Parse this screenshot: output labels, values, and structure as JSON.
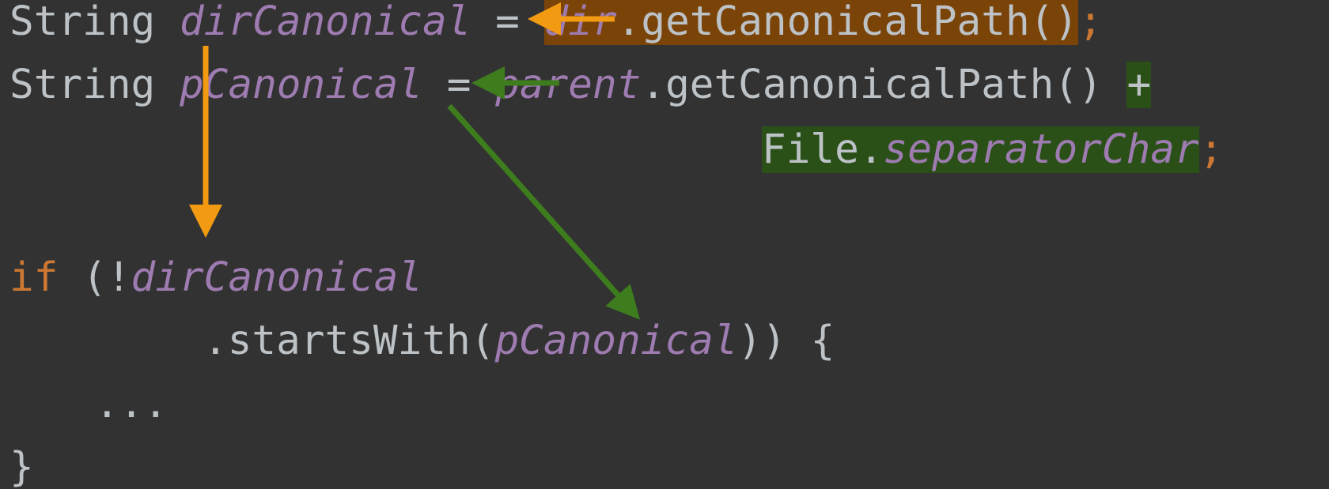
{
  "code": {
    "line1": {
      "type": "String",
      "var": "dirCanonical",
      "assign": " = ",
      "obj": "dir",
      "call": ".getCanonicalPath()",
      "semi": ";"
    },
    "line2": {
      "type": "String",
      "var": "pCanonical",
      "assign": " = ",
      "obj": "parent",
      "call": ".getCanonicalPath() ",
      "plus": "+"
    },
    "line3": {
      "cls": "File.",
      "field": "separatorChar",
      "semi": ";"
    },
    "line4": {
      "kw": "if",
      "open": " (!",
      "var": "dirCanonical"
    },
    "line5": {
      "method": ".startsWith(",
      "arg": "pCanonical",
      "close": ")) {"
    },
    "line6": {
      "ellipsis": "..."
    },
    "line7": {
      "brace": "}"
    }
  },
  "colors": {
    "background": "#323232",
    "text": "#bcc2c6",
    "variable": "#9e7bb0",
    "keyword": "#cc7832",
    "highlight_orange": "#7a4308",
    "highlight_green": "#2a5018",
    "arrow_orange": "#f29a12",
    "arrow_green": "#3e7d1e"
  }
}
